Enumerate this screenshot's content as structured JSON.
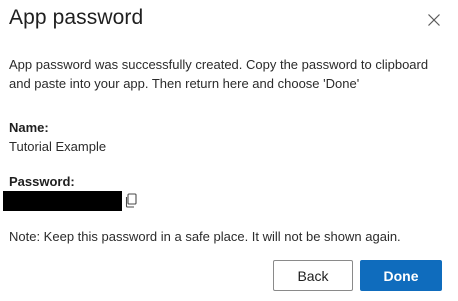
{
  "dialog": {
    "title": "App password",
    "close_icon": "close-icon",
    "message": "App password was successfully created. Copy the password to clipboard and paste into your app. Then return here and choose 'Done'",
    "name_label": "Name:",
    "name_value": "Tutorial Example",
    "password_label": "Password:",
    "copy_icon": "copy-icon",
    "note": "Note: Keep this password in a safe place. It will not be shown again.",
    "back_label": "Back",
    "done_label": "Done"
  },
  "colors": {
    "primary_button": "#0f6cbd",
    "password_mask": "#000000"
  }
}
